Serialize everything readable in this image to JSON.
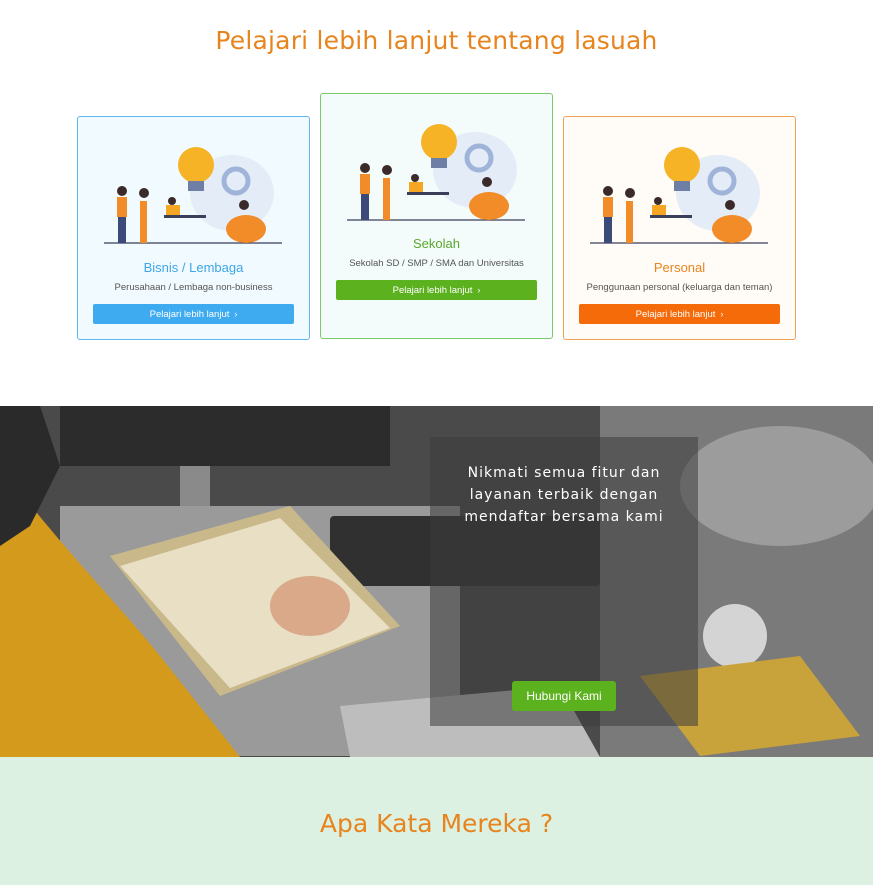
{
  "section_heading": "Pelajari lebih lanjut tentang lasuah",
  "cards": [
    {
      "title": "Bisnis / Lembaga",
      "subtitle": "Perusahaan / Lembaga non-business",
      "button": "Pelajari lebih lanjut",
      "accent": "#3eaaf0"
    },
    {
      "title": "Sekolah",
      "subtitle": "Sekolah SD / SMP / SMA dan Universitas",
      "button": "Pelajari lebih lanjut",
      "accent": "#5cb21e"
    },
    {
      "title": "Personal",
      "subtitle": "Penggunaan personal (keluarga dan teman)",
      "button": "Pelajari lebih lanjut",
      "accent": "#f56b0a"
    }
  ],
  "hero": {
    "text": "Nikmati semua fitur dan\nlayanan terbaik dengan\nmendaftar bersama kami",
    "button": "Hubungi Kami"
  },
  "testimonials": {
    "title": "Apa Kata Mereka ?"
  },
  "colors": {
    "heading": "#e8841e",
    "testimonial_bg": "#dcf1e2"
  }
}
